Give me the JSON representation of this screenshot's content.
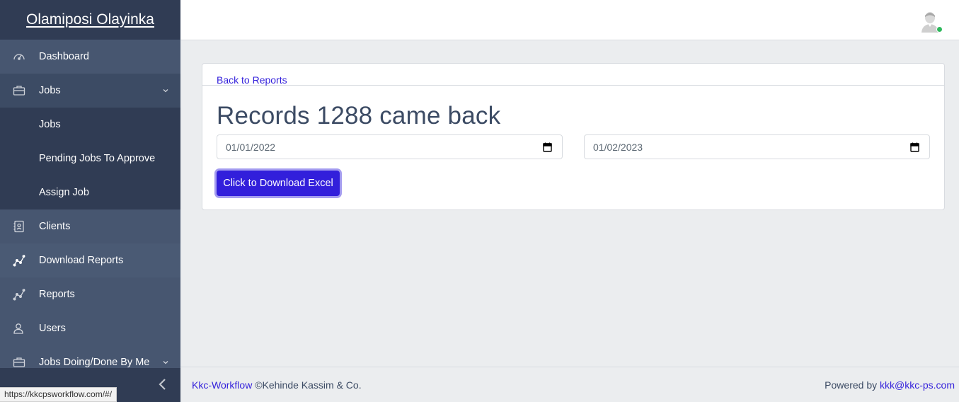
{
  "sidebar": {
    "brand": "Olamiposi Olayinka",
    "items": [
      {
        "label": "Dashboard",
        "icon": "speedometer-icon"
      },
      {
        "label": "Jobs",
        "icon": "briefcase-icon",
        "expanded": true
      },
      {
        "label": "Clients",
        "icon": "contact-icon"
      },
      {
        "label": "Download Reports",
        "icon": "chart-line-icon"
      },
      {
        "label": "Reports",
        "icon": "chart-line-icon"
      },
      {
        "label": "Users",
        "icon": "users-icon"
      },
      {
        "label": "Jobs Doing/Done By Me",
        "icon": "briefcase-icon"
      }
    ],
    "jobs_sub": [
      "Jobs",
      "Pending Jobs To Approve",
      "Assign Job"
    ]
  },
  "status_url": "https://kkcpsworkflow.com/#/",
  "main": {
    "back_link": "Back to Reports",
    "title": "Records 1288 came back",
    "start_date": "01/01/2022",
    "end_date": "01/02/2023",
    "download_button": "Click to Download Excel"
  },
  "footer": {
    "brand_link": "Kkc-Workflow",
    "copyright": "©Kehinde Kassim & Co.",
    "powered_by": "Powered by",
    "email": "kkk@kkc-ps.com"
  },
  "colors": {
    "sidebar": "#3c4b64",
    "primary": "#321fdb",
    "online": "#2eb85c"
  }
}
